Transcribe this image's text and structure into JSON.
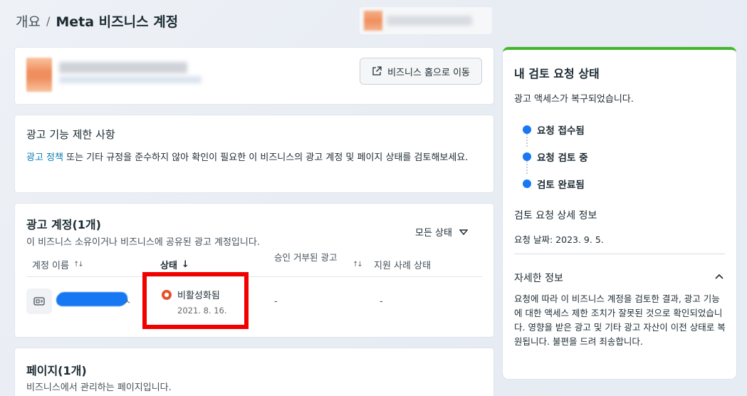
{
  "breadcrumb": {
    "root": "개요",
    "separator": "/",
    "current": "Meta 비즈니스 계정"
  },
  "business": {
    "home_button": "비즈니스 홈으로 이동"
  },
  "restrictions": {
    "title": "광고 기능 제한 사항",
    "link": "광고 정책",
    "text": " 또는 기타 규정을 준수하지 않아 확인이 필요한 이 비즈니스의 광고 계정 및 페이지 상태를 검토해보세요."
  },
  "ad_accounts": {
    "title": "광고 계정(1개)",
    "subtitle": "이 비즈니스 소유이거나 비즈니스에 공유된 광고 계정입니다.",
    "filter": "모든 상태",
    "columns": {
      "name": "계정 이름",
      "status": "상태",
      "rejected_ads": "승인 거부된 광고",
      "support_status": "지원 사례 상태"
    },
    "row": {
      "name_suffix": "ㅅ",
      "status": "비활성화됨",
      "status_date": "2021. 8. 16.",
      "rejected_ads": "-",
      "support_status": "-"
    }
  },
  "pages": {
    "title": "페이지(1개)",
    "subtitle": "비즈니스에서 관리하는 페이지입니다."
  },
  "review": {
    "title": "내 검토 요청 상태",
    "subtitle": "광고 액세스가 복구되었습니다.",
    "steps": [
      "요청 접수됨",
      "요청 검토 중",
      "검토 완료됨"
    ],
    "details_title": "검토 요청 상세 정보",
    "request_date": "요청 날짜: 2023. 9. 5.",
    "more_title": "자세한 정보",
    "more_text": "요청에 따라 이 비즈니스 계정을 검토한 결과, 광고 기능에 대한 액세스 제한 조치가 잘못된 것으로 확인되었습니다. 영향을 받은 광고 및 기타 광고 자산이 이전 상태로 복원됩니다. 불편을 드려 죄송합니다."
  },
  "colors": {
    "accent": "#1877f2",
    "success": "#42b72a",
    "error": "#e4532d",
    "highlight": "#f20000"
  }
}
